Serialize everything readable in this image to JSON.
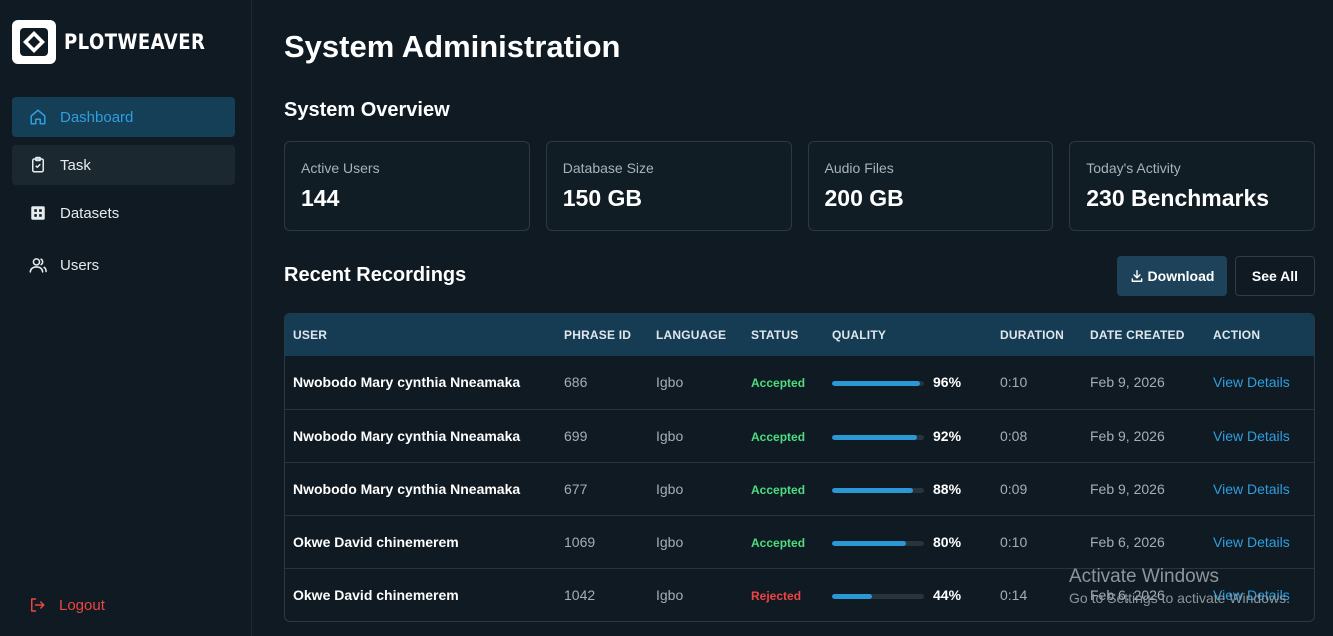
{
  "brand": {
    "name": "PLOTWEAVER"
  },
  "sidebar": {
    "items": [
      {
        "label": "Dashboard",
        "icon": "home-icon",
        "state": "active"
      },
      {
        "label": "Task",
        "icon": "clipboard-check-icon",
        "state": "hover"
      },
      {
        "label": "Datasets",
        "icon": "grid-icon",
        "state": "normal"
      },
      {
        "label": "Users",
        "icon": "users-icon",
        "state": "normal"
      }
    ],
    "logout": "Logout"
  },
  "main": {
    "title": "System Administration",
    "overview_title": "System Overview",
    "cards": [
      {
        "label": "Active Users",
        "value": "144"
      },
      {
        "label": "Database Size",
        "value": "150 GB"
      },
      {
        "label": "Audio Files",
        "value": "200 GB"
      },
      {
        "label": "Today's Activity",
        "value": "230 Benchmarks"
      }
    ],
    "recordings_title": "Recent Recordings",
    "download_label": "Download",
    "see_all_label": "See All"
  },
  "table": {
    "headers": [
      "USER",
      "PHRASE ID",
      "LANGUAGE",
      "STATUS",
      "QUALITY",
      "DURATION",
      "DATE CREATED",
      "ACTION"
    ],
    "rows": [
      {
        "user": "Nwobodo Mary cynthia Nneamaka",
        "phrase_id": "686",
        "language": "Igbo",
        "status": "Accepted",
        "quality": 96,
        "quality_text": "96%",
        "duration": "0:10",
        "date": "Feb 9, 2026",
        "action": "View Details"
      },
      {
        "user": "Nwobodo Mary cynthia Nneamaka",
        "phrase_id": "699",
        "language": "Igbo",
        "status": "Accepted",
        "quality": 92,
        "quality_text": "92%",
        "duration": "0:08",
        "date": "Feb 9, 2026",
        "action": "View Details"
      },
      {
        "user": "Nwobodo Mary cynthia Nneamaka",
        "phrase_id": "677",
        "language": "Igbo",
        "status": "Accepted",
        "quality": 88,
        "quality_text": "88%",
        "duration": "0:09",
        "date": "Feb 9, 2026",
        "action": "View Details"
      },
      {
        "user": "Okwe David chinemerem",
        "phrase_id": "1069",
        "language": "Igbo",
        "status": "Accepted",
        "quality": 80,
        "quality_text": "80%",
        "duration": "0:10",
        "date": "Feb 6, 2026",
        "action": "View Details"
      },
      {
        "user": "Okwe David chinemerem",
        "phrase_id": "1042",
        "language": "Igbo",
        "status": "Rejected",
        "quality": 44,
        "quality_text": "44%",
        "duration": "0:14",
        "date": "Feb 6, 2026",
        "action": "View Details"
      }
    ]
  },
  "colors": {
    "accepted": "#4ade80",
    "rejected": "#ef4444",
    "accent": "#2f9ee0"
  },
  "watermark": {
    "title": "Activate Windows",
    "subtitle": "Go to Settings to activate Windows."
  }
}
